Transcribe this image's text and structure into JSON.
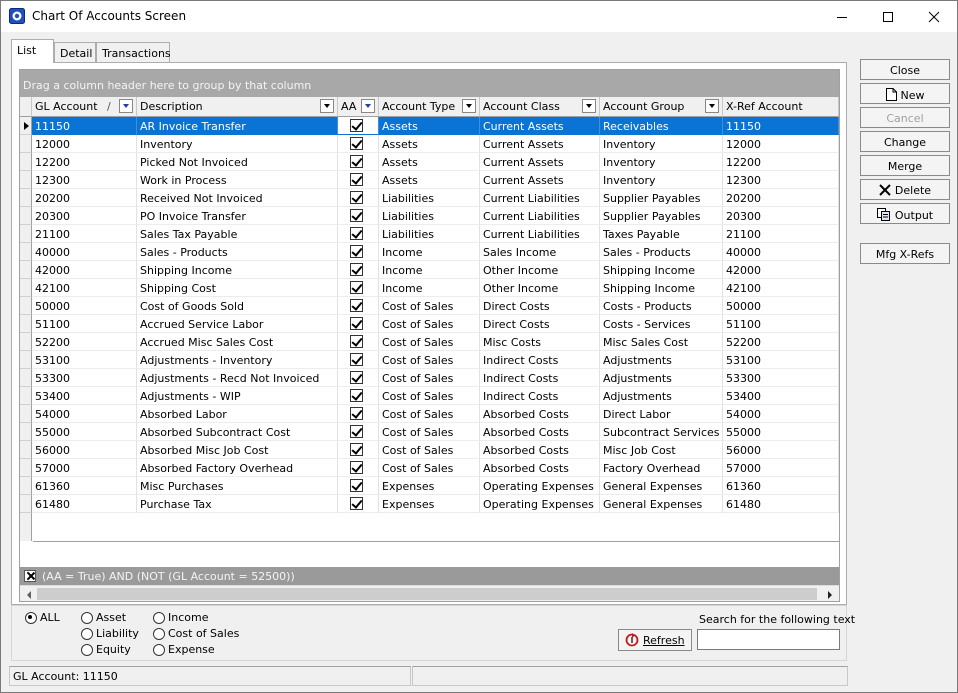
{
  "window": {
    "title": "Chart Of Accounts Screen"
  },
  "tabs": [
    {
      "label": "List"
    },
    {
      "label": "Detail"
    },
    {
      "label": "Transactions"
    }
  ],
  "grid": {
    "group_hint": "Drag a column header here to group by that column",
    "columns": [
      "GL Account",
      "Description",
      "AA",
      "Account Type",
      "Account Class",
      "Account Group",
      "X-Ref Account"
    ],
    "sort_glyph": "/",
    "selected_row": 0,
    "rows": [
      [
        "11150",
        "AR Invoice Transfer",
        true,
        "Assets",
        "Current Assets",
        "Receivables",
        "11150"
      ],
      [
        "12000",
        "Inventory",
        true,
        "Assets",
        "Current Assets",
        "Inventory",
        "12000"
      ],
      [
        "12200",
        "Picked Not Invoiced",
        true,
        "Assets",
        "Current Assets",
        "Inventory",
        "12200"
      ],
      [
        "12300",
        "Work in Process",
        true,
        "Assets",
        "Current Assets",
        "Inventory",
        "12300"
      ],
      [
        "20200",
        "Received Not Invoiced",
        true,
        "Liabilities",
        "Current Liabilities",
        "Supplier Payables",
        "20200"
      ],
      [
        "20300",
        "PO Invoice Transfer",
        true,
        "Liabilities",
        "Current Liabilities",
        "Supplier Payables",
        "20300"
      ],
      [
        "21100",
        "Sales Tax Payable",
        true,
        "Liabilities",
        "Current Liabilities",
        "Taxes Payable",
        "21100"
      ],
      [
        "40000",
        "Sales - Products",
        true,
        "Income",
        "Sales Income",
        "Sales - Products",
        "40000"
      ],
      [
        "42000",
        "Shipping Income",
        true,
        "Income",
        "Other Income",
        "Shipping Income",
        "42000"
      ],
      [
        "42100",
        "Shipping Cost",
        true,
        "Income",
        "Other Income",
        "Shipping Income",
        "42100"
      ],
      [
        "50000",
        "Cost of Goods Sold",
        true,
        "Cost of Sales",
        "Direct Costs",
        "Costs - Products",
        "50000"
      ],
      [
        "51100",
        "Accrued Service Labor",
        true,
        "Cost of Sales",
        "Direct Costs",
        "Costs - Services",
        "51100"
      ],
      [
        "52200",
        "Accrued Misc Sales Cost",
        true,
        "Cost of Sales",
        "Misc Costs",
        "Misc Sales Cost",
        "52200"
      ],
      [
        "53100",
        "Adjustments - Inventory",
        true,
        "Cost of Sales",
        "Indirect Costs",
        "Adjustments",
        "53100"
      ],
      [
        "53300",
        "Adjustments - Recd Not Invoiced",
        true,
        "Cost of Sales",
        "Indirect Costs",
        "Adjustments",
        "53300"
      ],
      [
        "53400",
        "Adjustments - WIP",
        true,
        "Cost of Sales",
        "Indirect Costs",
        "Adjustments",
        "53400"
      ],
      [
        "54000",
        "Absorbed Labor",
        true,
        "Cost of Sales",
        "Absorbed Costs",
        "Direct Labor",
        "54000"
      ],
      [
        "55000",
        "Absorbed Subcontract Cost",
        true,
        "Cost of Sales",
        "Absorbed Costs",
        "Subcontract Services",
        "55000"
      ],
      [
        "56000",
        "Absorbed Misc Job Cost",
        true,
        "Cost of Sales",
        "Absorbed Costs",
        "Misc Job Cost",
        "56000"
      ],
      [
        "57000",
        "Absorbed Factory Overhead",
        true,
        "Cost of Sales",
        "Absorbed Costs",
        "Factory Overhead",
        "57000"
      ],
      [
        "61360",
        "Misc Purchases",
        true,
        "Expenses",
        "Operating Expenses",
        "General Expenses",
        "61360"
      ],
      [
        "61480",
        "Purchase Tax",
        true,
        "Expenses",
        "Operating Expenses",
        "General Expenses",
        "61480"
      ]
    ],
    "filter_text": "(AA = True) AND (NOT (GL Account = 52500))"
  },
  "buttons": {
    "close": "Close",
    "new": "New",
    "cancel": "Cancel",
    "change": "Change",
    "merge": "Merge",
    "delete": "Delete",
    "output": "Output",
    "mfg_xrefs": "Mfg X-Refs"
  },
  "filters": {
    "all": "ALL",
    "asset": "Asset",
    "liability": "Liability",
    "equity": "Equity",
    "income": "Income",
    "cost_of_sales": "Cost of Sales",
    "expense": "Expense",
    "selected": "all"
  },
  "search": {
    "label": "Search for the following text",
    "value": ""
  },
  "refresh": {
    "label": "Refresh"
  },
  "status": {
    "left": "GL Account: 11150",
    "right": ""
  },
  "colors": {
    "selection": "#0a74d6",
    "group_area": "#a8a8a8"
  }
}
